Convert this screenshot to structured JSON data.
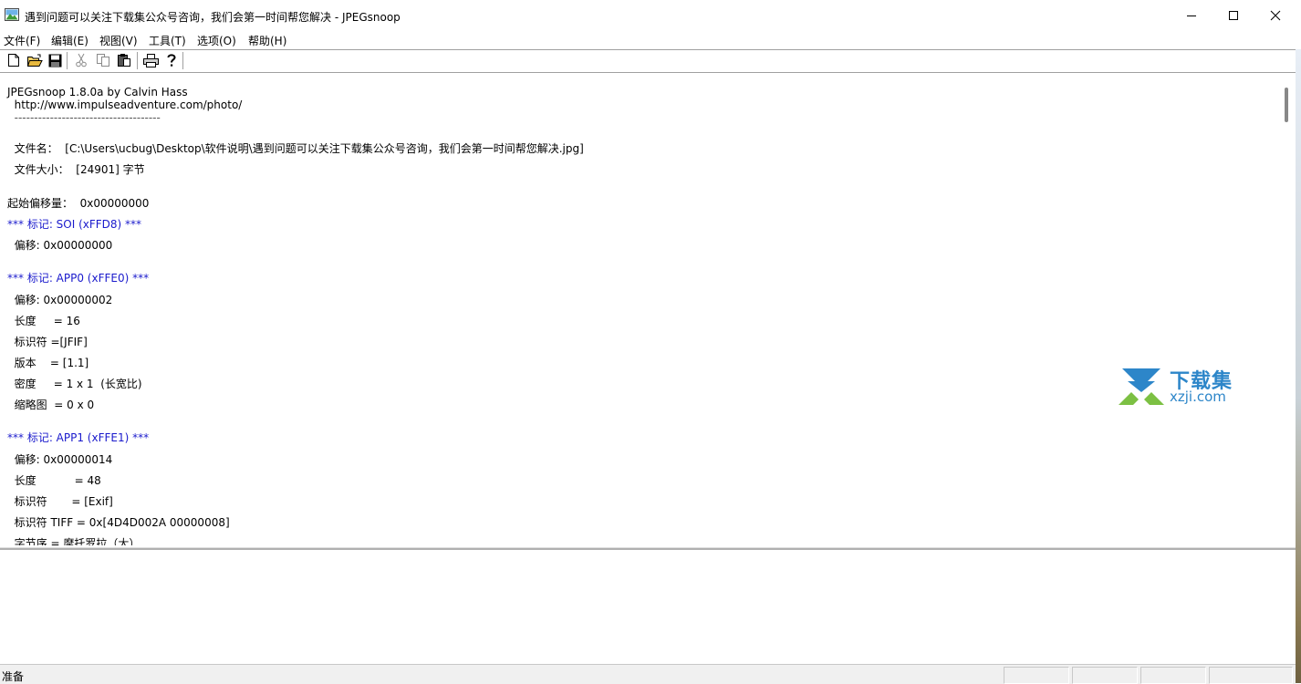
{
  "window": {
    "title": "遇到问题可以关注下载集公众号咨询，我们会第一时间帮您解决 - JPEGsnoop",
    "icon": "jpeg-image-icon"
  },
  "menu": [
    "文件(F)",
    "编辑(E)",
    "视图(V)",
    "工具(T)",
    "选项(O)",
    "帮助(H)"
  ],
  "toolbar": {
    "icons": [
      "new-file-icon",
      "open-folder-icon",
      "save-icon",
      "cut-icon",
      "copy-icon",
      "paste-icon",
      "print-icon",
      "help-icon"
    ]
  },
  "report": {
    "lines": [
      {
        "text": "JPEGsnoop 1.8.0a by Calvin Hass",
        "style": "normal"
      },
      {
        "text": "  http://www.impulseadventure.com/photo/",
        "style": "normal"
      },
      {
        "text": "  -------------------------------------",
        "style": "normal"
      },
      {
        "text": "  文件名：  [C:\\Users\\ucbug\\Desktop\\软件说明\\遇到问题可以关注下载集公众号咨询，我们会第一时间帮您解决.jpg]",
        "style": "normal"
      },
      {
        "text": "  文件大小：  [24901] 字节",
        "style": "normal"
      },
      {
        "text": "起始偏移量：  0x00000000",
        "style": "normal"
      },
      {
        "text": "*** 标记: SOI (xFFD8) ***",
        "style": "marker"
      },
      {
        "text": "  偏移: 0x00000000",
        "style": "normal"
      },
      {
        "text": "*** 标记: APP0 (xFFE0) ***",
        "style": "marker"
      },
      {
        "text": "  偏移: 0x00000002",
        "style": "normal"
      },
      {
        "text": "  长度     = 16",
        "style": "normal"
      },
      {
        "text": "  标识符 =[JFIF]",
        "style": "normal"
      },
      {
        "text": "  版本    = [1.1]",
        "style": "normal"
      },
      {
        "text": "  密度     = 1 x 1  (长宽比)",
        "style": "normal"
      },
      {
        "text": "  缩略图  = 0 x 0",
        "style": "normal"
      },
      {
        "text": "*** 标记: APP1 (xFFE1) ***",
        "style": "marker"
      },
      {
        "text": "  偏移: 0x00000014",
        "style": "normal"
      },
      {
        "text": "  长度           = 48",
        "style": "normal"
      },
      {
        "text": "  标识符       = [Exif]",
        "style": "normal"
      },
      {
        "text": "  标识符 TIFF = 0x[4D4D002A 00000008]",
        "style": "normal"
      },
      {
        "text": "  字节序 = 摩托罗拉（大）",
        "style": "normal"
      }
    ]
  },
  "status": {
    "text": "准备"
  },
  "watermark": {
    "name": "下载集",
    "url": "xzji.com"
  }
}
